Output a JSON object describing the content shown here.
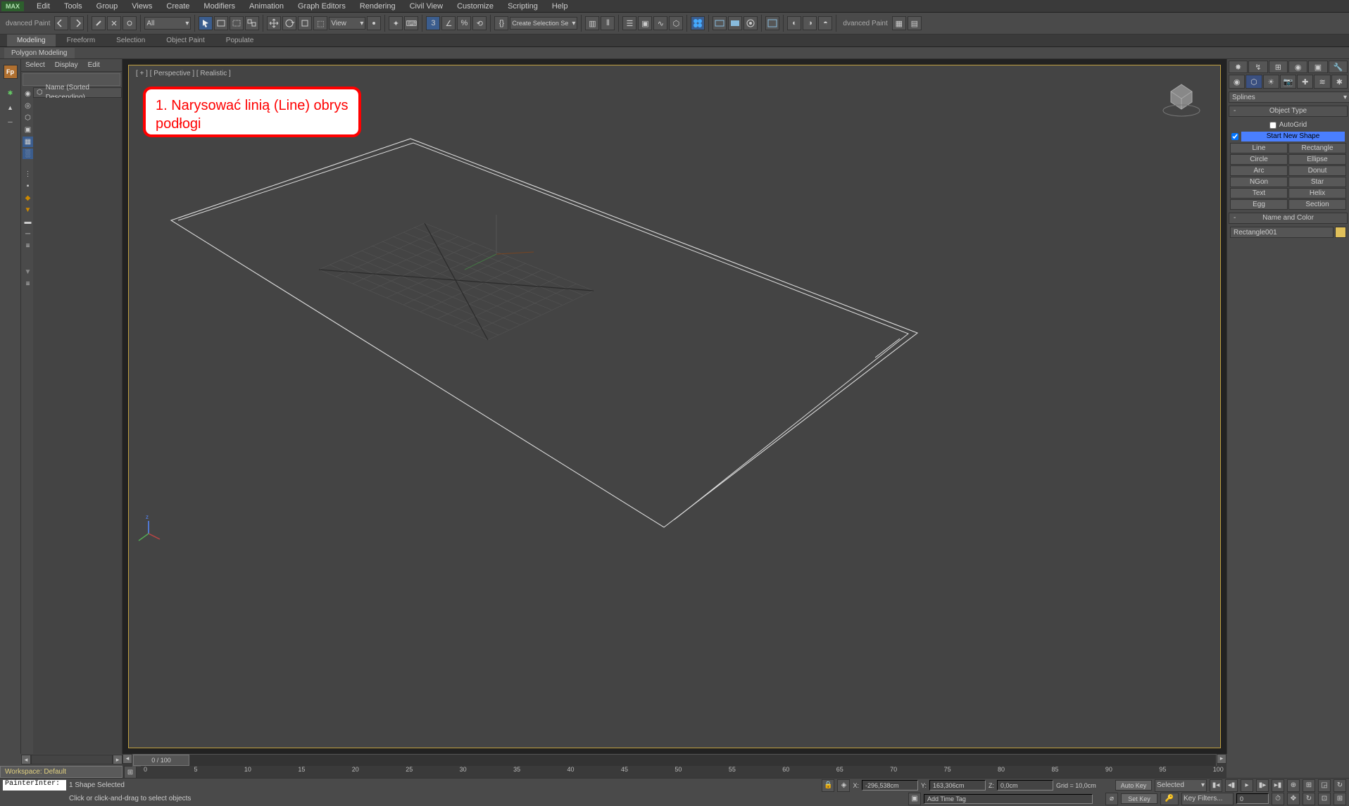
{
  "menu": {
    "app": "MAX",
    "items": [
      "Edit",
      "Tools",
      "Group",
      "Views",
      "Create",
      "Modifiers",
      "Animation",
      "Graph Editors",
      "Rendering",
      "Civil View",
      "Customize",
      "Scripting",
      "Help"
    ]
  },
  "toolbar": {
    "advanced_paint": "dvanced Paint",
    "all": "All",
    "view": "View",
    "create_sel_set": "Create Selection Se",
    "adv_paint2": "dvanced Paint"
  },
  "ribbon": {
    "tabs": [
      "Modeling",
      "Freeform",
      "Selection",
      "Object Paint",
      "Populate"
    ],
    "sub": "Polygon Modeling"
  },
  "scene_explorer": {
    "tabs": [
      "Select",
      "Display",
      "Edit"
    ],
    "col": "Name (Sorted Descending)"
  },
  "viewport": {
    "label": "[ + ] [ Perspective ] [ Realistic ]"
  },
  "annotation": {
    "text": "1. Narysować linią (Line) obrys podłogi"
  },
  "cmdpanel": {
    "dropdown": "Splines",
    "sections": {
      "objtype": "Object Type",
      "namecolor": "Name and Color"
    },
    "autogrid": "AutoGrid",
    "startnew": "Start New Shape",
    "buttons": [
      "Line",
      "Rectangle",
      "Circle",
      "Ellipse",
      "Arc",
      "Donut",
      "NGon",
      "Star",
      "Text",
      "Helix",
      "Egg",
      "Section"
    ],
    "name_value": "Rectangle001"
  },
  "timeline": {
    "pos": "0 / 100",
    "ticks": [
      "0",
      "5",
      "10",
      "15",
      "20",
      "25",
      "30",
      "35",
      "40",
      "45",
      "50",
      "55",
      "60",
      "65",
      "70",
      "75",
      "80",
      "85",
      "90",
      "95",
      "100"
    ]
  },
  "status": {
    "selection": "1 Shape Selected",
    "hint": "Click or click-and-drag to select objects",
    "workspace": "Workspace: Default",
    "painter": "PainterInter:",
    "x": "-296,538cm",
    "y": "163,306cm",
    "z": "0,0cm",
    "grid": "Grid = 10,0cm",
    "addtime": "Add Time Tag",
    "autokey": "Auto Key",
    "setkey": "Set Key",
    "selected": "Selected",
    "keyfilters": "Key Filters..."
  }
}
